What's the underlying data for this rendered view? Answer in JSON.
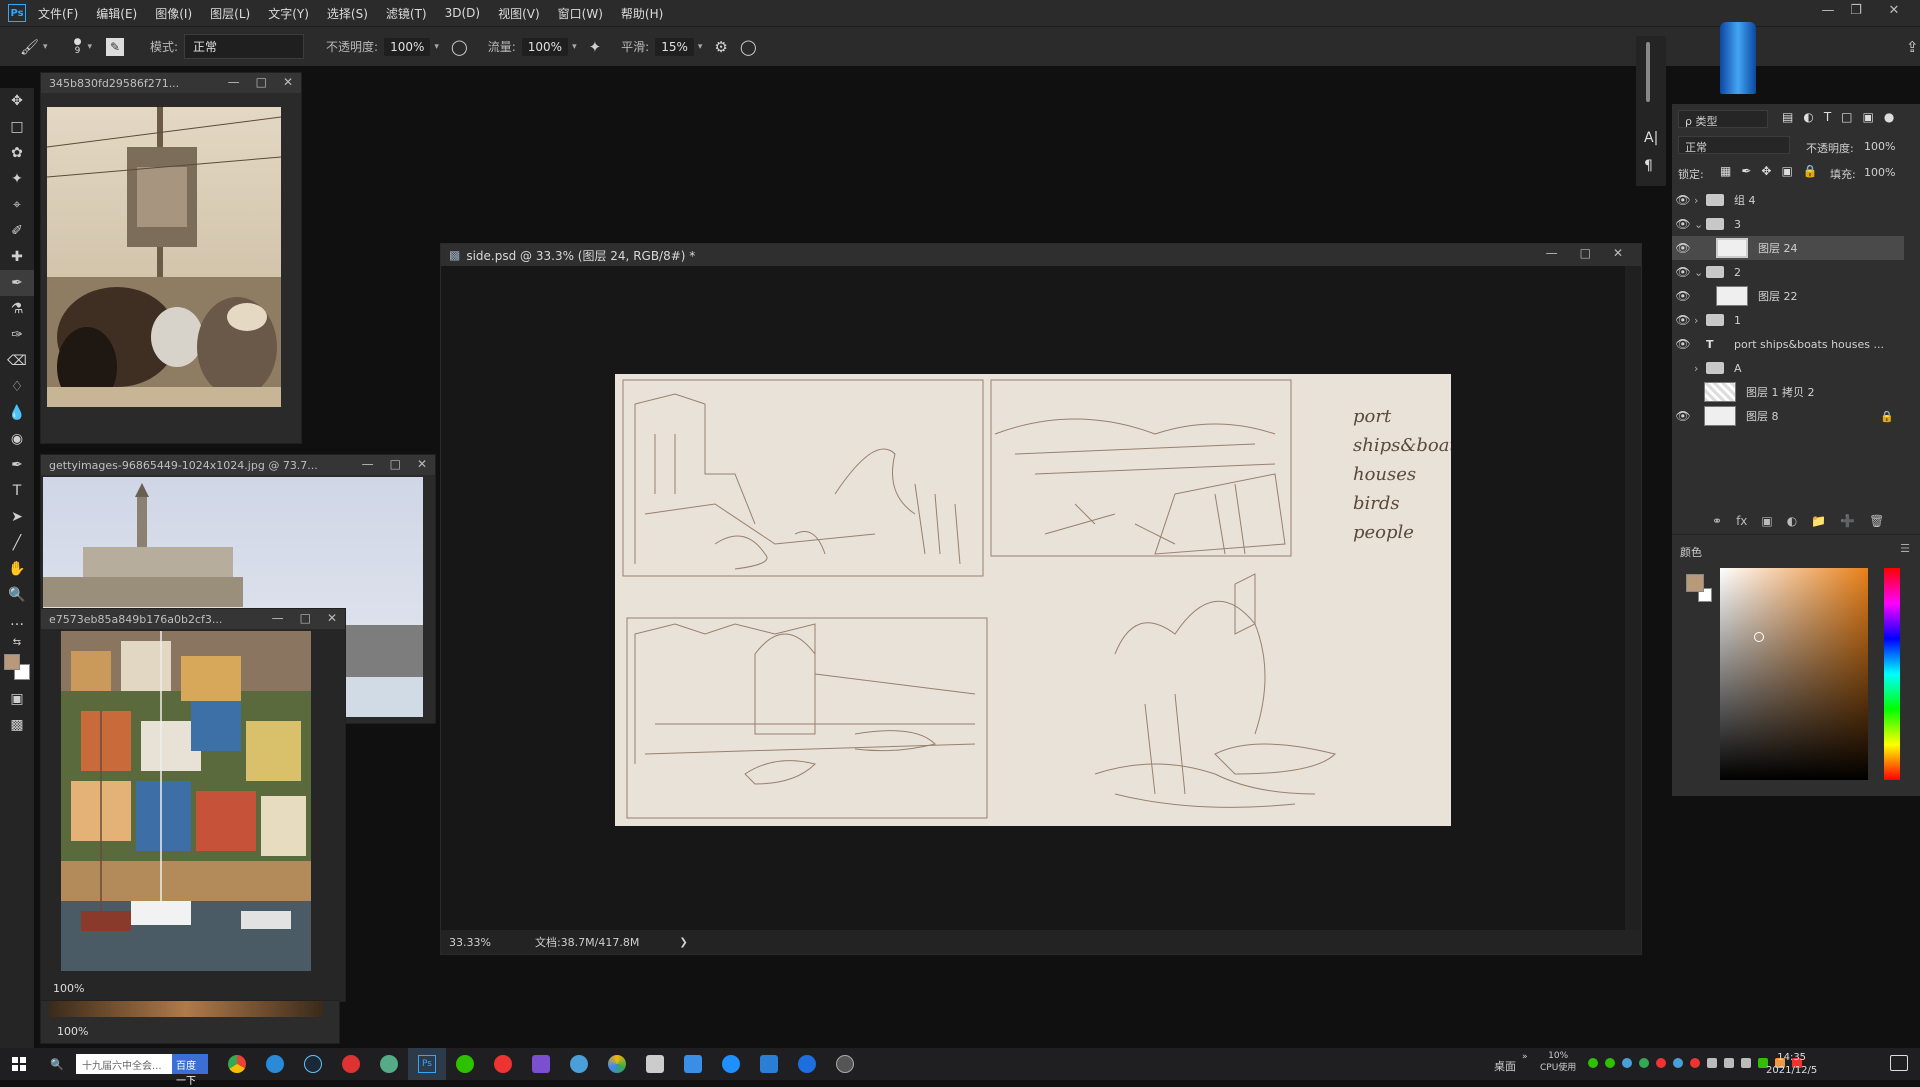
{
  "menu": {
    "logo": "Ps",
    "items": [
      "文件(F)",
      "编辑(E)",
      "图像(I)",
      "图层(L)",
      "文字(Y)",
      "选择(S)",
      "滤镜(T)",
      "3D(D)",
      "视图(V)",
      "窗口(W)",
      "帮助(H)"
    ],
    "window_minimize": "—",
    "window_restore": "❐",
    "window_close": "✕"
  },
  "options": {
    "brush_size": "9",
    "mode_label": "模式:",
    "mode_value": "正常",
    "opacity_label": "不透明度:",
    "opacity_value": "100%",
    "flow_label": "流量:",
    "flow_value": "100%",
    "smoothing_label": "平滑:",
    "smoothing_value": "15%"
  },
  "floating_windows": {
    "ref1_title": "345b830fd29586f271...",
    "ref2_title": "gettyimages-96865449-1024x1024.jpg @ 73.7...",
    "ref3_title": "e7573eb85a849b176a0b2cf3...",
    "ref3_zoom": "100%",
    "ref4_zoom": "100%"
  },
  "main_doc": {
    "title": "side.psd @ 33.3% (图层 24, RGB/8#) *",
    "zoom": "33.33%",
    "doc_size": "文档:38.7M/417.8M",
    "arrow": "❯",
    "sketch_notes": [
      "port",
      "ships&boats",
      "houses",
      "birds",
      "people"
    ]
  },
  "layers_panel": {
    "search_kind": "ρ 类型",
    "blend_mode": "正常",
    "opacity_label": "不透明度:",
    "opacity_value": "100%",
    "lock_label": "锁定:",
    "fill_label": "填充:",
    "fill_value": "100%",
    "layers": [
      {
        "name": "组 4",
        "type": "group",
        "visible": true,
        "expanded": false
      },
      {
        "name": "3",
        "type": "group",
        "visible": true,
        "expanded": true
      },
      {
        "name": "图层 24",
        "type": "layer",
        "visible": true,
        "selected": true
      },
      {
        "name": "2",
        "type": "group",
        "visible": true,
        "expanded": true
      },
      {
        "name": "图层 22",
        "type": "layer",
        "visible": true
      },
      {
        "name": "1",
        "type": "group",
        "visible": true,
        "expanded": false
      },
      {
        "name": "port ships&boats houses ...",
        "type": "text",
        "visible": true
      },
      {
        "name": "A",
        "type": "group",
        "visible": false,
        "expanded": false
      },
      {
        "name": "图层 1 拷贝 2",
        "type": "layer",
        "visible": false
      },
      {
        "name": "图层 8",
        "type": "layer",
        "visible": true,
        "locked": true
      }
    ]
  },
  "color_panel": {
    "title": "颜色",
    "foreground": "#b89a7a",
    "background": "#ffffff"
  },
  "taskbar": {
    "search_placeholder": "十九届六中全会...",
    "search_button": "百度一下",
    "desktop_label": "桌面",
    "cpu_pct": "10%",
    "cpu_label": "CPU使用",
    "time": "14:35",
    "date": "2021/12/5"
  }
}
